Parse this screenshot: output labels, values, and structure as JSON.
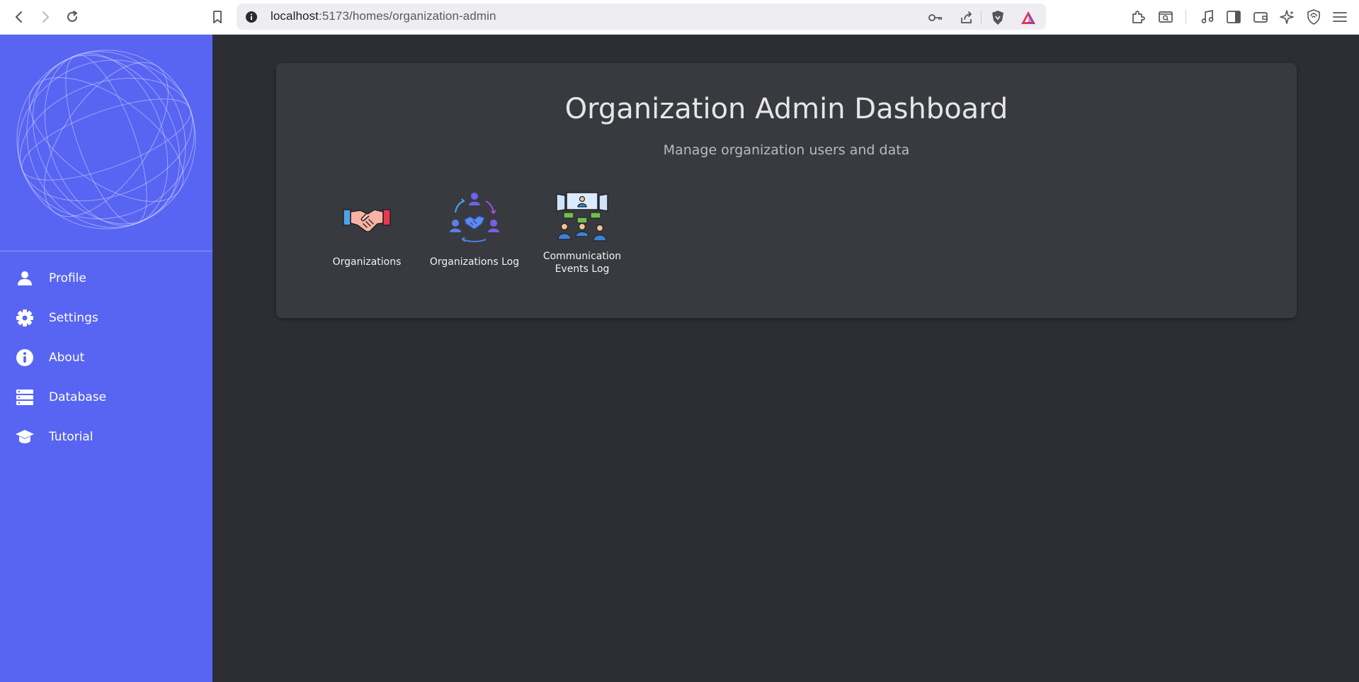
{
  "browser": {
    "url_host": "localhost",
    "url_path": ":5173/homes/organization-admin"
  },
  "sidebar": {
    "items": [
      {
        "label": "Profile",
        "icon": "person-icon"
      },
      {
        "label": "Settings",
        "icon": "gear-icon"
      },
      {
        "label": "About",
        "icon": "info-icon"
      },
      {
        "label": "Database",
        "icon": "database-icon"
      },
      {
        "label": "Tutorial",
        "icon": "graduation-cap-icon"
      }
    ]
  },
  "dashboard": {
    "title": "Organization Admin Dashboard",
    "subtitle": "Manage organization users and data",
    "tiles": [
      {
        "label": "Organizations",
        "icon": "handshake-icon"
      },
      {
        "label": "Organizations Log",
        "icon": "network-handshake-icon"
      },
      {
        "label": "Communication Events Log",
        "icon": "meeting-screens-icon"
      }
    ]
  },
  "colors": {
    "sidebar": "#5865f2",
    "background": "#2c2e33",
    "card": "#383a40"
  }
}
